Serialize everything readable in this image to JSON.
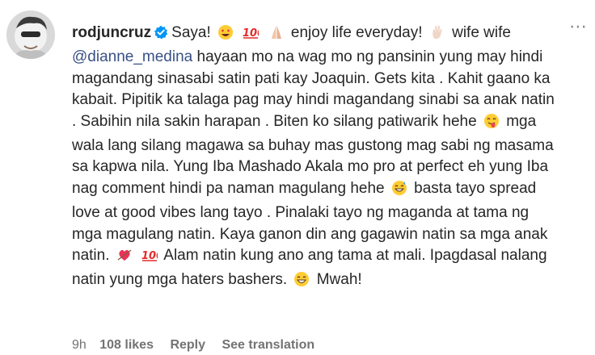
{
  "comment": {
    "username": "rodjuncruz",
    "verified": true,
    "segments": [
      {
        "t": "text",
        "v": "Saya!"
      },
      {
        "t": "emoji",
        "icon": "heart-eyes-emoji"
      },
      {
        "t": "emoji",
        "icon": "hundred-points-emoji"
      },
      {
        "t": "emoji",
        "icon": "praying-hands-emoji"
      },
      {
        "t": "text",
        "v": "enjoy life everyday!"
      },
      {
        "t": "emoji",
        "icon": "waving-hand-emoji"
      },
      {
        "t": "text",
        "v": "wife wife"
      },
      {
        "t": "mention",
        "v": "@dianne_medina"
      },
      {
        "t": "text",
        "v": "hayaan mo na wag mo ng pansinin yung may hindi magandang sinasabi satin pati kay Joaquin. Gets kita . Kahit gaano ka kabait. Pipitik ka talaga pag may hindi magandang sinabi sa anak natin . Sabihin nila sakin harapan . Biten ko silang patiwarik hehe"
      },
      {
        "t": "emoji",
        "icon": "zany-face-emoji"
      },
      {
        "t": "text",
        "v": "mga wala lang silang magawa sa buhay mas gustong mag sabi ng masama sa kapwa nila. Yung Iba Mashado Akala mo pro at perfect eh yung Iba nag comment hindi pa naman magulang hehe"
      },
      {
        "t": "emoji",
        "icon": "grinning-sweat-emoji"
      },
      {
        "t": "text",
        "v": "basta tayo spread love at good vibes lang tayo . Pinalaki tayo ng maganda at tama ng mga magulang natin. Kaya ganon din ang gagawin natin sa mga anak natin."
      },
      {
        "t": "emoji",
        "icon": "heart-arrow-emoji"
      },
      {
        "t": "emoji",
        "icon": "hundred-points-emoji"
      },
      {
        "t": "text",
        "v": "Alam natin kung ano ang tama at mali. Ipagdasal nalang natin yung mga haters bashers."
      },
      {
        "t": "emoji",
        "icon": "grinning-smile-emoji"
      },
      {
        "t": "text",
        "v": "Mwah!"
      }
    ]
  },
  "meta": {
    "time": "9h",
    "likes": "108 likes",
    "reply": "Reply",
    "translate": "See translation"
  },
  "colors": {
    "text": "#262626",
    "mention": "#385185",
    "meta": "#737373",
    "verified": "#0095f6"
  },
  "more_icon": "more-options-icon"
}
